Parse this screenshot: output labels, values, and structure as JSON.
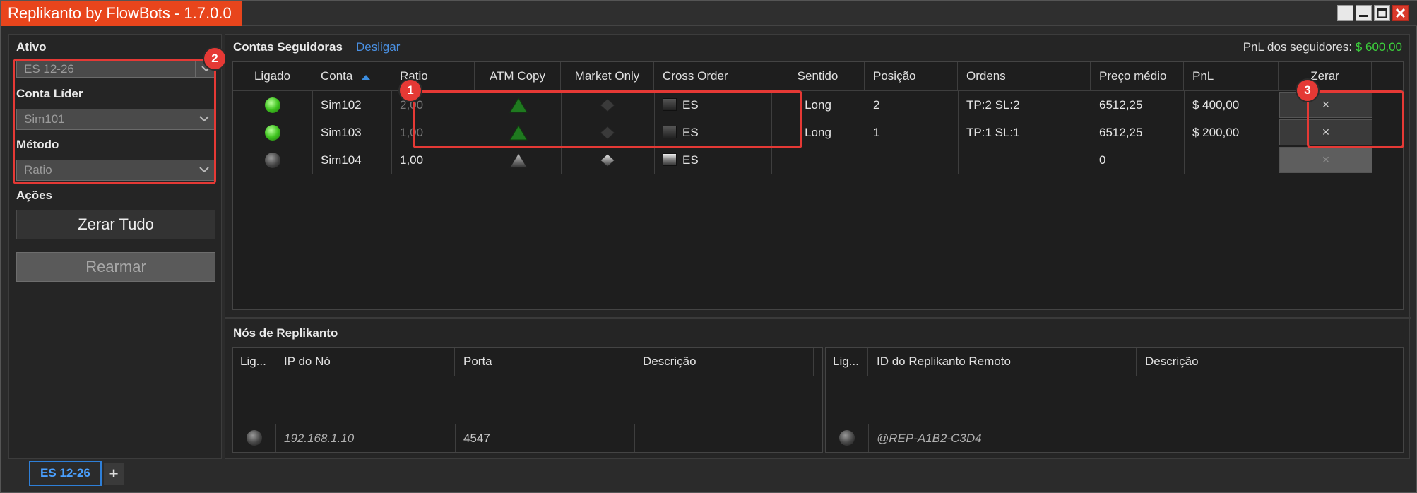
{
  "window": {
    "title": "Replikanto by FlowBots - 1.7.0.0"
  },
  "sidebar": {
    "ativo_label": "Ativo",
    "ativo_value": "ES 12-26",
    "conta_lider_label": "Conta Líder",
    "conta_lider_value": "Sim101",
    "metodo_label": "Método",
    "metodo_value": "Ratio",
    "acoes_label": "Ações",
    "zerar_tudo": "Zerar Tudo",
    "rearmar": "Rearmar"
  },
  "followers": {
    "heading": "Contas Seguidoras",
    "disconnect_link": "Desligar",
    "pnl_label": "PnL dos seguidores:",
    "pnl_value": "$ 600,00",
    "columns": [
      "Ligado",
      "Conta",
      "Ratio",
      "ATM Copy",
      "Market Only",
      "Cross Order",
      "Sentido",
      "Posição",
      "Ordens",
      "Preço médio",
      "PnL",
      "Zerar"
    ],
    "rows": [
      {
        "on": true,
        "conta": "Sim102",
        "ratio": "2,00",
        "ratio_disabled": true,
        "atm": true,
        "cross": "ES",
        "sentido": "Long",
        "posicao": "2",
        "ordens": "TP:2 SL:2",
        "preco": "6512,25",
        "pnl": "$ 400,00",
        "zerar": "×",
        "zerar_enabled": true
      },
      {
        "on": true,
        "conta": "Sim103",
        "ratio": "1,00",
        "ratio_disabled": true,
        "atm": true,
        "cross": "ES",
        "sentido": "Long",
        "posicao": "1",
        "ordens": "TP:1 SL:1",
        "preco": "6512,25",
        "pnl": "$ 200,00",
        "zerar": "×",
        "zerar_enabled": true
      },
      {
        "on": false,
        "conta": "Sim104",
        "ratio": "1,00",
        "ratio_disabled": false,
        "atm": false,
        "cross": "ES",
        "sentido": "",
        "posicao": "",
        "ordens": "",
        "preco": "0",
        "pnl": "",
        "zerar": "×",
        "zerar_enabled": false
      }
    ]
  },
  "nodes": {
    "heading": "Nós de Replikanto",
    "left_columns": [
      "Lig...",
      "IP do Nó",
      "Porta",
      "Descrição"
    ],
    "left_row": {
      "ip": "192.168.1.10",
      "porta": "4547",
      "descricao": ""
    },
    "right_columns": [
      "Lig...",
      "ID do Replikanto Remoto",
      "Descrição"
    ],
    "right_row": {
      "id": "@REP-A1B2-C3D4",
      "descricao": ""
    }
  },
  "tabs": {
    "active": "ES 12-26",
    "add": "+"
  },
  "badges": [
    "1",
    "2",
    "3"
  ],
  "colors": {
    "accent": "#e8451c",
    "positive": "#3ccf3c",
    "link": "#4a90e2",
    "highlight": "#e53935"
  }
}
